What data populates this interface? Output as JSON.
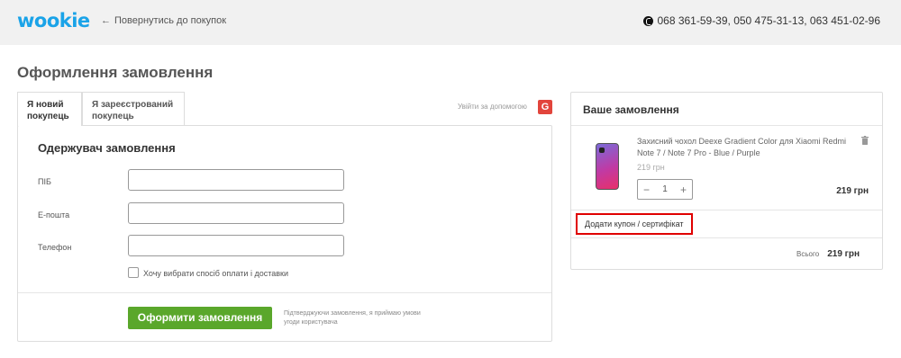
{
  "header": {
    "logo": "wookie",
    "back_label": "Повернутись до покупок",
    "phones": "068 361-59-39,  050 475-31-13,  063 451-02-96"
  },
  "page_title": "Оформлення замовлення",
  "tabs": [
    {
      "label": "Я новий покупець",
      "active": true
    },
    {
      "label": "Я зареєстрований покупець",
      "active": false
    }
  ],
  "help": {
    "label": "Увійти за допомогою",
    "icon": "google-icon",
    "icon_text": "G",
    "color": "#e2453c"
  },
  "form": {
    "section_title": "Одержувач замовлення",
    "fields": [
      {
        "label": "ПІБ",
        "value": ""
      },
      {
        "label": "E-пошта",
        "value": ""
      },
      {
        "label": "Телефон",
        "value": ""
      }
    ],
    "checkbox_label": "Хочу вибрати спосіб оплати і доставки",
    "checkbox_checked": false,
    "submit_label": "Оформити замовлення",
    "submit_color": "#5aa72b",
    "terms_text": "Підтверджуючи замовлення, я приймаю умови угоди користувача"
  },
  "order": {
    "title": "Ваше замовлення",
    "item": {
      "name": "Захисний чохол Deexe Gradient Color для Xiaomi Redmi Note 7 / Note 7 Pro - Blue / Purple",
      "unit_price": "219 грн",
      "quantity": "1",
      "line_total": "219 грн"
    },
    "coupon_label": "Додати купон / сертифікат",
    "coupon_highlight_color": "#e00000",
    "total_label": "Всього",
    "total_value": "219 грн"
  }
}
